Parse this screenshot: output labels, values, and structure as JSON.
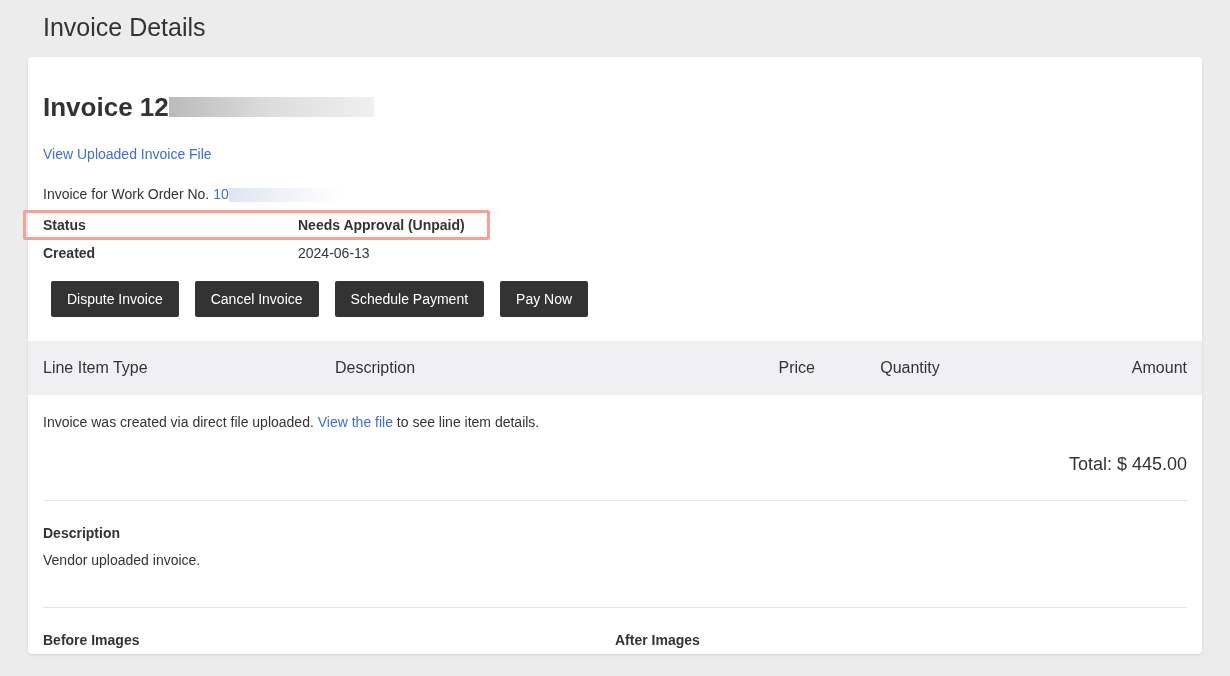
{
  "page_title": "Invoice Details",
  "invoice": {
    "heading": "Invoice 12",
    "file_link": "View Uploaded Invoice File",
    "work_order_label": "Invoice for Work Order No.",
    "work_order_number": "10",
    "fields": [
      {
        "label": "Status",
        "value": "Needs Approval (Unpaid)",
        "highlighted": true
      },
      {
        "label": "Created",
        "value": "2024-06-13",
        "highlighted": false
      }
    ],
    "buttons": [
      "Dispute Invoice",
      "Cancel Invoice",
      "Schedule Payment",
      "Pay Now"
    ]
  },
  "table": {
    "columns": [
      "Line Item Type",
      "Description",
      "Price",
      "Quantity",
      "Amount"
    ],
    "note": "Invoice was created via direct file uploaded. ",
    "note_link": "View the file",
    "note_end": " to see line item details.",
    "total": "Total: $ 445.00"
  },
  "description": {
    "label": "Description",
    "text": "Vendor uploaded invoice."
  },
  "images": [
    {
      "label": "Before Images"
    },
    {
      "label": "After Images"
    }
  ]
}
